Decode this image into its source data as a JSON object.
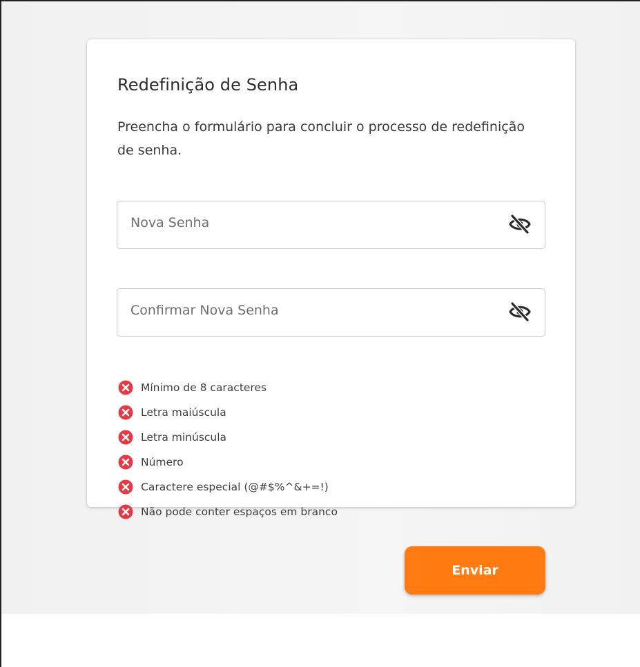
{
  "form": {
    "title": "Redefinição de Senha",
    "subtitle": "Preencha o formulário para concluir o processo de redefinição de senha.",
    "new_password": {
      "placeholder": "Nova Senha",
      "value": ""
    },
    "confirm_password": {
      "placeholder": "Confirmar Nova Senha",
      "value": ""
    },
    "rules": [
      {
        "label": "Mínimo de 8 caracteres",
        "status": "fail"
      },
      {
        "label": "Letra maiúscula",
        "status": "fail"
      },
      {
        "label": "Letra minúscula",
        "status": "fail"
      },
      {
        "label": "Número",
        "status": "fail"
      },
      {
        "label": "Caractere especial (@#$%^&+=!)",
        "status": "fail"
      },
      {
        "label": "Não pode conter espaços em branco",
        "status": "fail"
      }
    ],
    "submit_label": "Enviar",
    "icons": {
      "visibility_toggle": "eye-off-icon",
      "rule_status": "error-circle-icon"
    }
  },
  "colors": {
    "accent": "#ff7a10",
    "error": "#e53945",
    "background": "#f3f3f3",
    "card": "#ffffff"
  }
}
